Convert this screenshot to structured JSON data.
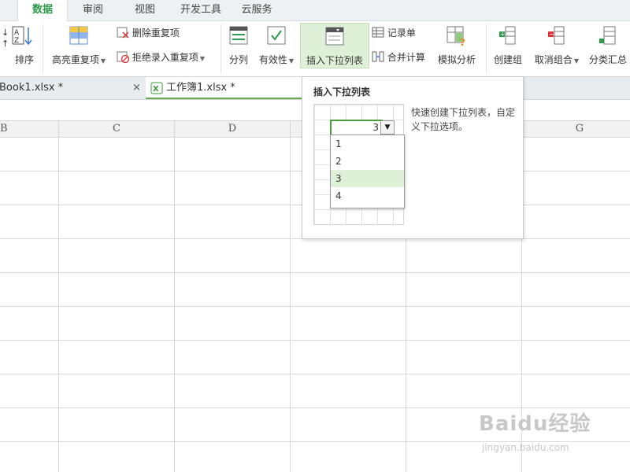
{
  "ribbon_tabs": [
    "数据",
    "审阅",
    "视图",
    "开发工具",
    "云服务"
  ],
  "active_tab": "数据",
  "ribbon": {
    "sort": "排序",
    "highlight_dup": "高亮重复项",
    "delete_dup": "删除重复项",
    "reject_dup": "拒绝录入重复项",
    "split": "分列",
    "validity": "有效性",
    "insert_dropdown": "插入下拉列表",
    "record_sheet": "记录单",
    "merge_calc": "合并计算",
    "simulate": "模拟分析",
    "create_group": "创建组",
    "ungroup": "取消组合",
    "subtotal": "分类汇总"
  },
  "doc_tabs": {
    "tab1": "Book1.xlsx *",
    "tab2": "工作簿1.xlsx *",
    "close": "×"
  },
  "columns": [
    "B",
    "C",
    "D",
    "G"
  ],
  "popup": {
    "title": "插入下拉列表",
    "preview_value": "3",
    "options": [
      "1",
      "2",
      "3",
      "4"
    ],
    "selected": "3",
    "desc": "快速创建下拉列表，自定义下拉选项。"
  },
  "watermark": {
    "line1": "Baidu经验",
    "line2": "jingyan.baidu.com"
  },
  "colors": {
    "accent": "#2e9a4b",
    "selection": "#dff0d8"
  }
}
